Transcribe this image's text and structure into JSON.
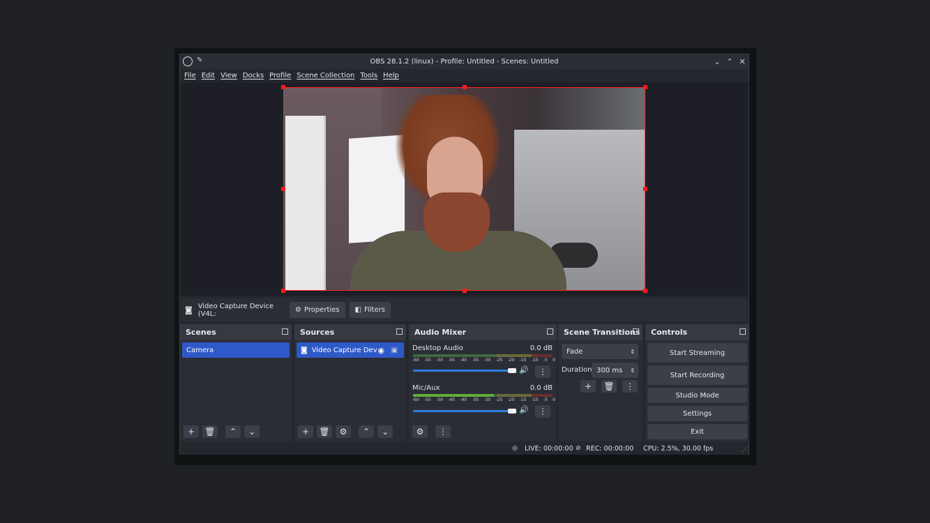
{
  "window": {
    "title": "OBS 28.1.2 (linux) - Profile: Untitled - Scenes: Untitled"
  },
  "menu": [
    "File",
    "Edit",
    "View",
    "Docks",
    "Profile",
    "Scene Collection",
    "Tools",
    "Help"
  ],
  "source_toolbar": {
    "source_name": "Video Capture Device (V4L:",
    "properties_label": "Properties",
    "filters_label": "Filters"
  },
  "scenes": {
    "header": "Scenes",
    "items": [
      "Camera"
    ]
  },
  "sources": {
    "header": "Sources",
    "items": [
      "Video Capture Dev"
    ]
  },
  "audio_mixer": {
    "header": "Audio Mixer",
    "channels": [
      {
        "name": "Desktop Audio",
        "level": "0.0 dB",
        "volume_fraction": 0.97
      },
      {
        "name": "Mic/Aux",
        "level": "0.0 dB",
        "volume_fraction": 0.97
      }
    ],
    "scale": [
      "-60",
      "-55",
      "-50",
      "-45",
      "-40",
      "-35",
      "-30",
      "-25",
      "-20",
      "-15",
      "-10",
      "-5",
      "0"
    ]
  },
  "scene_transitions": {
    "header": "Scene Transitions",
    "transition": "Fade",
    "duration_label": "Duration",
    "duration_value": "300 ms"
  },
  "controls": {
    "header": "Controls",
    "start_streaming": "Start Streaming",
    "start_recording": "Start Recording",
    "studio_mode": "Studio Mode",
    "settings": "Settings",
    "exit": "Exit"
  },
  "status": {
    "live": "LIVE: 00:00:00",
    "rec": "REC: 00:00:00",
    "cpu": "CPU: 2.5%, 30.00 fps"
  },
  "colors": {
    "accent": "#2e59c9",
    "selection_border": "#ff2020",
    "background": "#25272f"
  }
}
